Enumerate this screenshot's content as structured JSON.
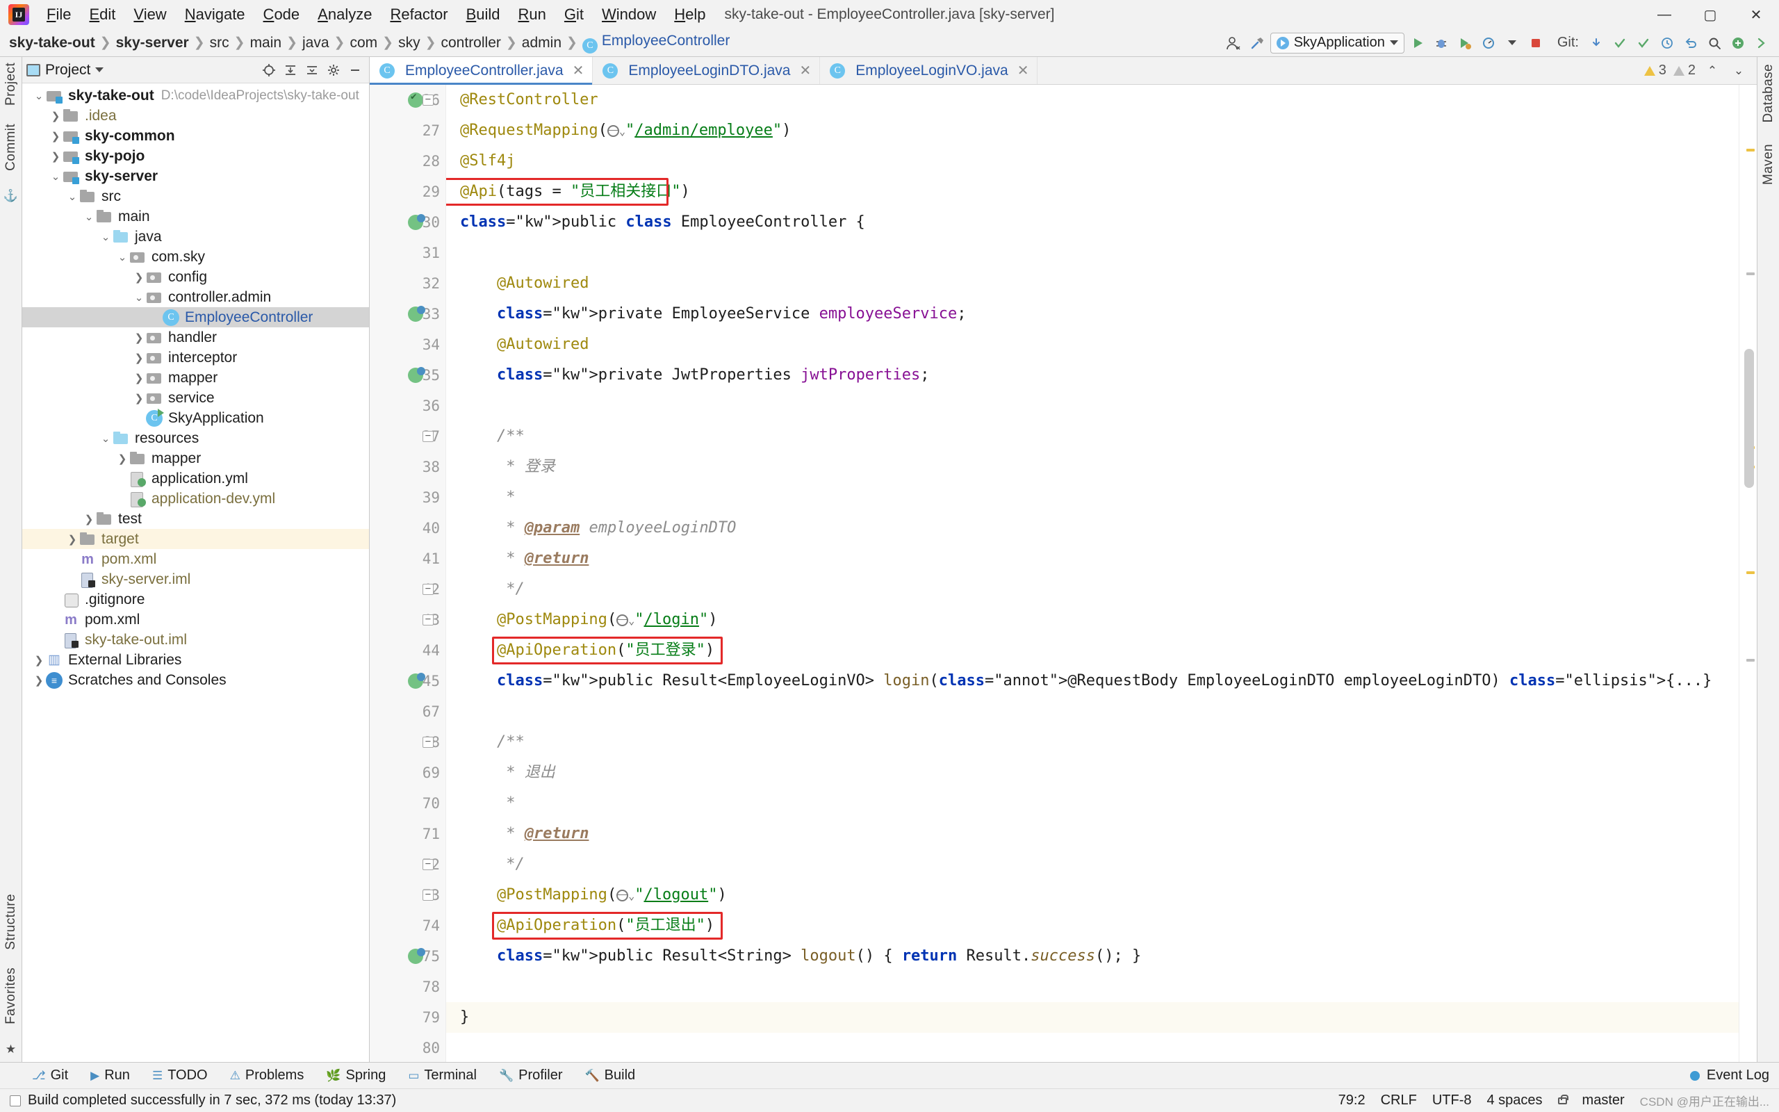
{
  "window": {
    "title": "sky-take-out - EmployeeController.java [sky-server]",
    "minimize": "—",
    "maximize": "▢",
    "close": "✕"
  },
  "menubar": {
    "items": [
      "File",
      "Edit",
      "View",
      "Navigate",
      "Code",
      "Analyze",
      "Refactor",
      "Build",
      "Run",
      "Git",
      "Window",
      "Help"
    ]
  },
  "breadcrumb": {
    "items": [
      {
        "label": "sky-take-out",
        "style": "bold"
      },
      {
        "label": "sky-server",
        "style": "bold"
      },
      {
        "label": "src",
        "style": "normal"
      },
      {
        "label": "main",
        "style": "normal"
      },
      {
        "label": "java",
        "style": "normal"
      },
      {
        "label": "com",
        "style": "normal"
      },
      {
        "label": "sky",
        "style": "normal"
      },
      {
        "label": "controller",
        "style": "normal"
      },
      {
        "label": "admin",
        "style": "normal"
      },
      {
        "label": "EmployeeController",
        "style": "class"
      }
    ]
  },
  "toolbar": {
    "run_config": "SkyApplication",
    "git_label": "Git:",
    "icons": [
      "user-icon",
      "hammer-build-icon",
      "run-icon",
      "debug-icon",
      "coverage-icon",
      "profiler-icon",
      "stop-icon",
      "git-update-icon",
      "git-commit-icon",
      "git-push-icon",
      "git-history-icon",
      "undo-icon",
      "search-icon",
      "plus-icon",
      "forward-icon"
    ]
  },
  "left_rail": {
    "items": [
      "Project",
      "Commit",
      "Structure",
      "Favorites"
    ]
  },
  "right_rail": {
    "items": [
      "Database",
      "Maven"
    ]
  },
  "project_panel": {
    "title": "Project",
    "tools": [
      "target-icon",
      "collapse-expand-icon",
      "collapse-all-icon",
      "settings-gear-icon",
      "hide-icon"
    ],
    "tree": [
      {
        "indent": 0,
        "arrow": "v",
        "icon": "folder-mod",
        "label": "sky-take-out",
        "bold": true,
        "path": "D:\\code\\IdeaProjects\\sky-take-out"
      },
      {
        "indent": 1,
        "arrow": ">",
        "icon": "folder",
        "label": ".idea",
        "color": "brown"
      },
      {
        "indent": 1,
        "arrow": ">",
        "icon": "folder-mod",
        "label": "sky-common",
        "bold": true
      },
      {
        "indent": 1,
        "arrow": ">",
        "icon": "folder-mod",
        "label": "sky-pojo",
        "bold": true
      },
      {
        "indent": 1,
        "arrow": "v",
        "icon": "folder-mod",
        "label": "sky-server",
        "bold": true
      },
      {
        "indent": 2,
        "arrow": "v",
        "icon": "folder",
        "label": "src"
      },
      {
        "indent": 3,
        "arrow": "v",
        "icon": "folder",
        "label": "main"
      },
      {
        "indent": 4,
        "arrow": "v",
        "icon": "folder-src",
        "label": "java"
      },
      {
        "indent": 5,
        "arrow": "v",
        "icon": "folder-pkg",
        "label": "com.sky"
      },
      {
        "indent": 6,
        "arrow": ">",
        "icon": "folder-pkg",
        "label": "config"
      },
      {
        "indent": 6,
        "arrow": "v",
        "icon": "folder-pkg",
        "label": "controller.admin"
      },
      {
        "indent": 7,
        "arrow": "",
        "icon": "cls",
        "label": "EmployeeController",
        "color": "blue",
        "selected": true
      },
      {
        "indent": 6,
        "arrow": ">",
        "icon": "folder-pkg",
        "label": "handler"
      },
      {
        "indent": 6,
        "arrow": ">",
        "icon": "folder-pkg",
        "label": "interceptor"
      },
      {
        "indent": 6,
        "arrow": ">",
        "icon": "folder-pkg",
        "label": "mapper"
      },
      {
        "indent": 6,
        "arrow": ">",
        "icon": "folder-pkg",
        "label": "service"
      },
      {
        "indent": 6,
        "arrow": "",
        "icon": "clsrun",
        "label": "SkyApplication"
      },
      {
        "indent": 4,
        "arrow": "v",
        "icon": "folder-src",
        "label": "resources"
      },
      {
        "indent": 5,
        "arrow": ">",
        "icon": "folder",
        "label": "mapper"
      },
      {
        "indent": 5,
        "arrow": "",
        "icon": "yml",
        "label": "application.yml"
      },
      {
        "indent": 5,
        "arrow": "",
        "icon": "yml",
        "label": "application-dev.yml",
        "color": "brown"
      },
      {
        "indent": 3,
        "arrow": ">",
        "icon": "folder",
        "label": "test"
      },
      {
        "indent": 2,
        "arrow": ">",
        "icon": "folder",
        "label": "target",
        "color": "brown",
        "highlight": true
      },
      {
        "indent": 2,
        "arrow": "",
        "icon": "xml",
        "label": "pom.xml",
        "color": "brown"
      },
      {
        "indent": 2,
        "arrow": "",
        "icon": "iml",
        "label": "sky-server.iml",
        "color": "brown"
      },
      {
        "indent": 1,
        "arrow": "",
        "icon": "git",
        "label": ".gitignore"
      },
      {
        "indent": 1,
        "arrow": "",
        "icon": "xml",
        "label": "pom.xml"
      },
      {
        "indent": 1,
        "arrow": "",
        "icon": "iml",
        "label": "sky-take-out.iml",
        "color": "brown"
      },
      {
        "indent": 0,
        "arrow": ">",
        "icon": "lib",
        "label": "External Libraries"
      },
      {
        "indent": 0,
        "arrow": ">",
        "icon": "scratch",
        "label": "Scratches and Consoles"
      }
    ]
  },
  "editor": {
    "tabs": [
      {
        "label": "EmployeeController.java",
        "active": true,
        "icon": "java-class-icon",
        "close": "✕"
      },
      {
        "label": "EmployeeLoginDTO.java",
        "active": false,
        "icon": "java-class-icon",
        "close": "✕"
      },
      {
        "label": "EmployeeLoginVO.java",
        "active": false,
        "icon": "java-class-icon",
        "close": "✕"
      }
    ],
    "inspection": {
      "warnings": "3",
      "weak_warnings": "2"
    },
    "lines": [
      {
        "num": "26",
        "mark": "bean",
        "fold": "minus",
        "text": "@RestController"
      },
      {
        "num": "27",
        "mark": "",
        "fold": "",
        "text": "@RequestMapping(\"/admin/employee\")"
      },
      {
        "num": "28",
        "mark": "",
        "fold": "",
        "text": "@Slf4j"
      },
      {
        "num": "29",
        "mark": "",
        "fold": "",
        "text": "@Api(tags = \"员工相关接口\")",
        "box": true
      },
      {
        "num": "30",
        "mark": "bean2",
        "fold": "",
        "text": "public class EmployeeController {"
      },
      {
        "num": "31",
        "mark": "",
        "fold": "",
        "text": ""
      },
      {
        "num": "32",
        "mark": "",
        "fold": "",
        "text": "    @Autowired"
      },
      {
        "num": "33",
        "mark": "bean2",
        "fold": "",
        "text": "    private EmployeeService employeeService;"
      },
      {
        "num": "34",
        "mark": "",
        "fold": "",
        "text": "    @Autowired"
      },
      {
        "num": "35",
        "mark": "bean2",
        "fold": "",
        "text": "    private JwtProperties jwtProperties;"
      },
      {
        "num": "36",
        "mark": "",
        "fold": "",
        "text": ""
      },
      {
        "num": "37",
        "mark": "",
        "fold": "minus",
        "text": "    /**"
      },
      {
        "num": "38",
        "mark": "",
        "fold": "",
        "text": "     * 登录"
      },
      {
        "num": "39",
        "mark": "",
        "fold": "",
        "text": "     *"
      },
      {
        "num": "40",
        "mark": "",
        "fold": "",
        "text": "     * @param employeeLoginDTO"
      },
      {
        "num": "41",
        "mark": "",
        "fold": "",
        "text": "     * @return"
      },
      {
        "num": "42",
        "mark": "",
        "fold": "minus",
        "text": "     */"
      },
      {
        "num": "43",
        "mark": "",
        "fold": "minus",
        "text": "    @PostMapping(\"/login\")"
      },
      {
        "num": "44",
        "mark": "",
        "fold": "",
        "text": "    @ApiOperation(\"员工登录\")",
        "box": true
      },
      {
        "num": "45",
        "mark": "bean2",
        "fold": "",
        "text": "    public Result<EmployeeLoginVO> login(@RequestBody EmployeeLoginDTO employeeLoginDTO) {...}"
      },
      {
        "num": "67",
        "mark": "",
        "fold": "",
        "text": ""
      },
      {
        "num": "68",
        "mark": "",
        "fold": "minus",
        "text": "    /**"
      },
      {
        "num": "69",
        "mark": "",
        "fold": "",
        "text": "     * 退出"
      },
      {
        "num": "70",
        "mark": "",
        "fold": "",
        "text": "     *"
      },
      {
        "num": "71",
        "mark": "",
        "fold": "",
        "text": "     * @return"
      },
      {
        "num": "72",
        "mark": "",
        "fold": "minus",
        "text": "     */"
      },
      {
        "num": "73",
        "mark": "",
        "fold": "minus",
        "text": "    @PostMapping(\"/logout\")"
      },
      {
        "num": "74",
        "mark": "",
        "fold": "",
        "text": "    @ApiOperation(\"员工退出\")",
        "box": true
      },
      {
        "num": "75",
        "mark": "bean2",
        "fold": "",
        "text": "    public Result<String> logout() { return Result.success(); }"
      },
      {
        "num": "78",
        "mark": "",
        "fold": "",
        "text": ""
      },
      {
        "num": "79",
        "mark": "",
        "fold": "",
        "text": "}",
        "current": true
      },
      {
        "num": "80",
        "mark": "",
        "fold": "",
        "text": ""
      }
    ]
  },
  "bottom_toolwindows": {
    "items": [
      {
        "label": "Git",
        "icon": "git-branch-icon"
      },
      {
        "label": "Run",
        "icon": "run-icon"
      },
      {
        "label": "TODO",
        "icon": "todo-list-icon"
      },
      {
        "label": "Problems",
        "icon": "problems-icon"
      },
      {
        "label": "Spring",
        "icon": "spring-leaf-icon"
      },
      {
        "label": "Terminal",
        "icon": "terminal-icon"
      },
      {
        "label": "Profiler",
        "icon": "profiler-icon"
      },
      {
        "label": "Build",
        "icon": "hammer-build-icon"
      }
    ],
    "event_log": "Event Log"
  },
  "statusbar": {
    "message": "Build completed successfully in 7 sec, 372 ms (today 13:37)",
    "caret": "79:2",
    "line_sep": "CRLF",
    "encoding": "UTF-8",
    "indent": "4 spaces",
    "branch": "master",
    "watermark": "CSDN @用户正在输出..."
  },
  "colors": {
    "accent": "#4a86c8",
    "annotation_box": "#e32929",
    "annotation_text": "#9e880d",
    "keyword": "#0033b3",
    "string": "#067d17",
    "comment": "#8c8c8c",
    "link": "#2a59a8"
  }
}
